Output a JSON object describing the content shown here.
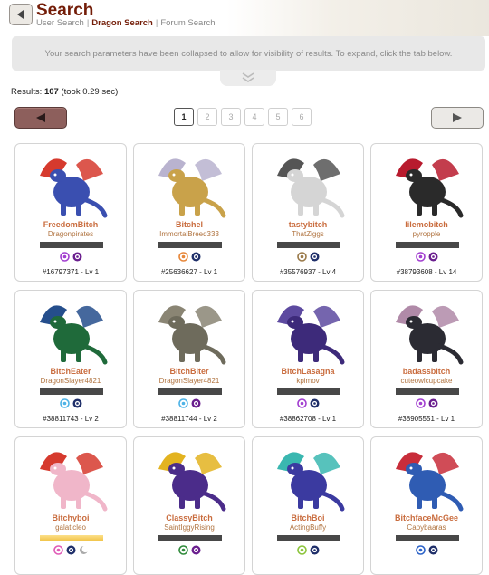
{
  "header": {
    "title": "Search",
    "breadcrumb": [
      "User Search",
      "Dragon Search",
      "Forum Search"
    ],
    "active_index": 1
  },
  "notice": "Your search parameters have been collapsed to allow for visibility of results. To expand, click the tab below.",
  "results": {
    "label": "Results:",
    "count": "107",
    "time": "(took 0.29 sec)"
  },
  "pagination": {
    "pages": [
      "1",
      "2",
      "3",
      "4",
      "5",
      "6"
    ],
    "current": "1"
  },
  "colors": {
    "brand": "#731d08",
    "name": "#c96c3e",
    "owner": "#b0733f"
  },
  "dragons": [
    {
      "name": "FreedomBitch",
      "owner": "Dragonpirates",
      "info": "#16797371 - Lv 1",
      "icons": [
        "swirl-purple-icon",
        "eye-purple-icon"
      ],
      "bar": "dark",
      "palette": [
        "#3a4fb0",
        "#d63a2e"
      ]
    },
    {
      "name": "Bitchel",
      "owner": "ImmortalBreed333",
      "info": "#25636627 - Lv 1",
      "icons": [
        "flame-orange-icon",
        "eye-navy-icon"
      ],
      "bar": "dark",
      "palette": [
        "#c9a24a",
        "#b9b3cf"
      ]
    },
    {
      "name": "tastybitch",
      "owner": "ThatZiggs",
      "info": "#35576937 - Lv 4",
      "icons": [
        "earth-tan-icon",
        "eye-navy-icon"
      ],
      "bar": "dark",
      "palette": [
        "#d5d5d5",
        "#555555"
      ]
    },
    {
      "name": "lilemobitch",
      "owner": "pyropple",
      "info": "#38793608 - Lv 14",
      "icons": [
        "swirl-purple-icon",
        "eye-purple-icon"
      ],
      "bar": "dark",
      "palette": [
        "#2a2a2a",
        "#b81b2e"
      ]
    },
    {
      "name": "BitchEater",
      "owner": "DragonSlayer4821",
      "info": "#38811743 - Lv 2",
      "icons": [
        "ice-blue-icon",
        "eye-navy-icon"
      ],
      "bar": "dark",
      "palette": [
        "#1f6a3a",
        "#254e8c"
      ]
    },
    {
      "name": "BitchBiter",
      "owner": "DragonSlayer4821",
      "info": "#38811744 - Lv 2",
      "icons": [
        "ice-blue-icon",
        "eye-purple-icon"
      ],
      "bar": "dark",
      "palette": [
        "#6e6b5c",
        "#8a8574"
      ]
    },
    {
      "name": "BitchLasagna",
      "owner": "kpimov",
      "info": "#38862708 - Lv 1",
      "icons": [
        "swirl-purple-icon",
        "eye-navy-icon"
      ],
      "bar": "dark",
      "palette": [
        "#3d2a7a",
        "#5d4aa0"
      ]
    },
    {
      "name": "badassbitch",
      "owner": "cuteowlcupcake",
      "info": "#38905551 - Lv 1",
      "icons": [
        "swirl-purple-icon",
        "eye-purple-icon"
      ],
      "bar": "dark",
      "palette": [
        "#2b2b33",
        "#b08aa8"
      ]
    },
    {
      "name": "Bitchyboi",
      "owner": "galaticleo",
      "info": "",
      "icons": [
        "swirl-pink-icon",
        "eye-navy-icon",
        "moon-gray-icon"
      ],
      "bar": "gold",
      "palette": [
        "#f0b6c9",
        "#d63a2e"
      ]
    },
    {
      "name": "ClassyBitch",
      "owner": "SaintIggyRising",
      "info": "",
      "icons": [
        "plant-green-icon",
        "eye-purple-icon"
      ],
      "bar": "dark",
      "palette": [
        "#4b2c8a",
        "#e3b320"
      ]
    },
    {
      "name": "BitchBoi",
      "owner": "ActingBuffy",
      "info": "",
      "icons": [
        "wind-green-icon",
        "eye-navy-icon"
      ],
      "bar": "dark",
      "palette": [
        "#3b3aa0",
        "#3ab7b0"
      ]
    },
    {
      "name": "BitchfaceMcGee",
      "owner": "Capybaaras",
      "info": "",
      "icons": [
        "water-blue-icon",
        "eye-navy-icon"
      ],
      "bar": "dark",
      "palette": [
        "#2f5cb3",
        "#c82d3a"
      ]
    }
  ]
}
